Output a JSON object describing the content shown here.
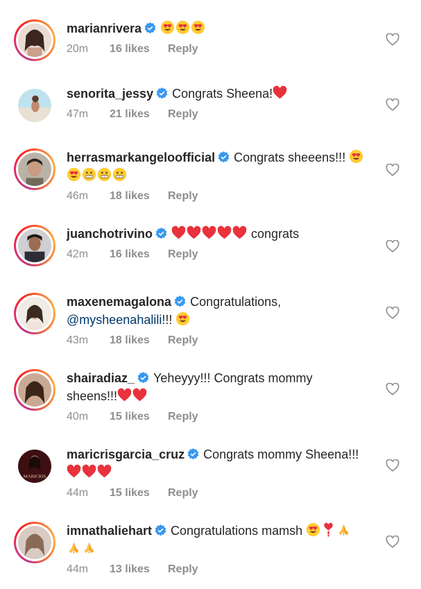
{
  "comments": [
    {
      "username": "marianrivera",
      "text": "",
      "emojis_after": [
        "heart-eyes",
        "heart-eyes",
        "heart-eyes"
      ],
      "time": "20m",
      "likes": "16 likes",
      "reply": "Reply",
      "verified": true,
      "avatar_color": "#b58b73"
    },
    {
      "username": "senorita_jessy",
      "text": "Congrats Sheena!",
      "emojis_after": [
        "red-heart"
      ],
      "time": "47m",
      "likes": "21 likes",
      "reply": "Reply",
      "verified": true,
      "avatar_color": "#8fc7d8"
    },
    {
      "username": "herrasmarkangeloofficial",
      "text": "Congrats sheeens!!!",
      "emojis_after": [
        "heart-eyes"
      ],
      "line2_emojis": [
        "heart-eyes",
        "grimace",
        "grimace",
        "grimace"
      ],
      "time": "46m",
      "likes": "18 likes",
      "reply": "Reply",
      "verified": true,
      "avatar_color": "#9a8a7a"
    },
    {
      "username": "juanchotrivino",
      "text": "congrats",
      "emojis_before": [
        "red-heart",
        "red-heart",
        "red-heart",
        "red-heart",
        "red-heart"
      ],
      "time": "42m",
      "likes": "16 likes",
      "reply": "Reply",
      "verified": true,
      "avatar_color": "#4a4a55"
    },
    {
      "username": "maxenemagalona",
      "text": "Congratulations,",
      "mention": "@mysheenahalili",
      "after_mention": "!!!",
      "line2_emojis": [
        "heart-eyes"
      ],
      "time": "43m",
      "likes": "18 likes",
      "reply": "Reply",
      "verified": true,
      "avatar_color": "#d9c6b8"
    },
    {
      "username": "shairadiaz_",
      "text": "Yeheyyy!!! Congrats mommy",
      "line2": "sheens!!!",
      "line2_emojis": [
        "red-heart",
        "red-heart"
      ],
      "time": "40m",
      "likes": "15 likes",
      "reply": "Reply",
      "verified": true,
      "avatar_color": "#7a5b4c"
    },
    {
      "username": "maricrisgarcia_cruz",
      "text": "Congrats mommy Sheena!!!",
      "line2_emojis": [
        "red-heart",
        "red-heart",
        "red-heart"
      ],
      "time": "44m",
      "likes": "15 likes",
      "reply": "Reply",
      "verified": true,
      "avatar_color": "#5a1c1e",
      "avatar_text": "MARICRIS"
    },
    {
      "username": "imnathaliehart",
      "text": "Congratulations mamsh",
      "emojis_after": [
        "heart-eyes",
        "exclamation-heart",
        "folded-hands"
      ],
      "line2_emojis": [
        "folded-hands",
        "folded-hands"
      ],
      "time": "44m",
      "likes": "13 likes",
      "reply": "Reply",
      "verified": true,
      "avatar_color": "#a88f86"
    }
  ],
  "colors": {
    "verified": "#3897f0",
    "meta": "#8e8e8e",
    "mention": "#00376b",
    "heart": "#ed4956"
  }
}
